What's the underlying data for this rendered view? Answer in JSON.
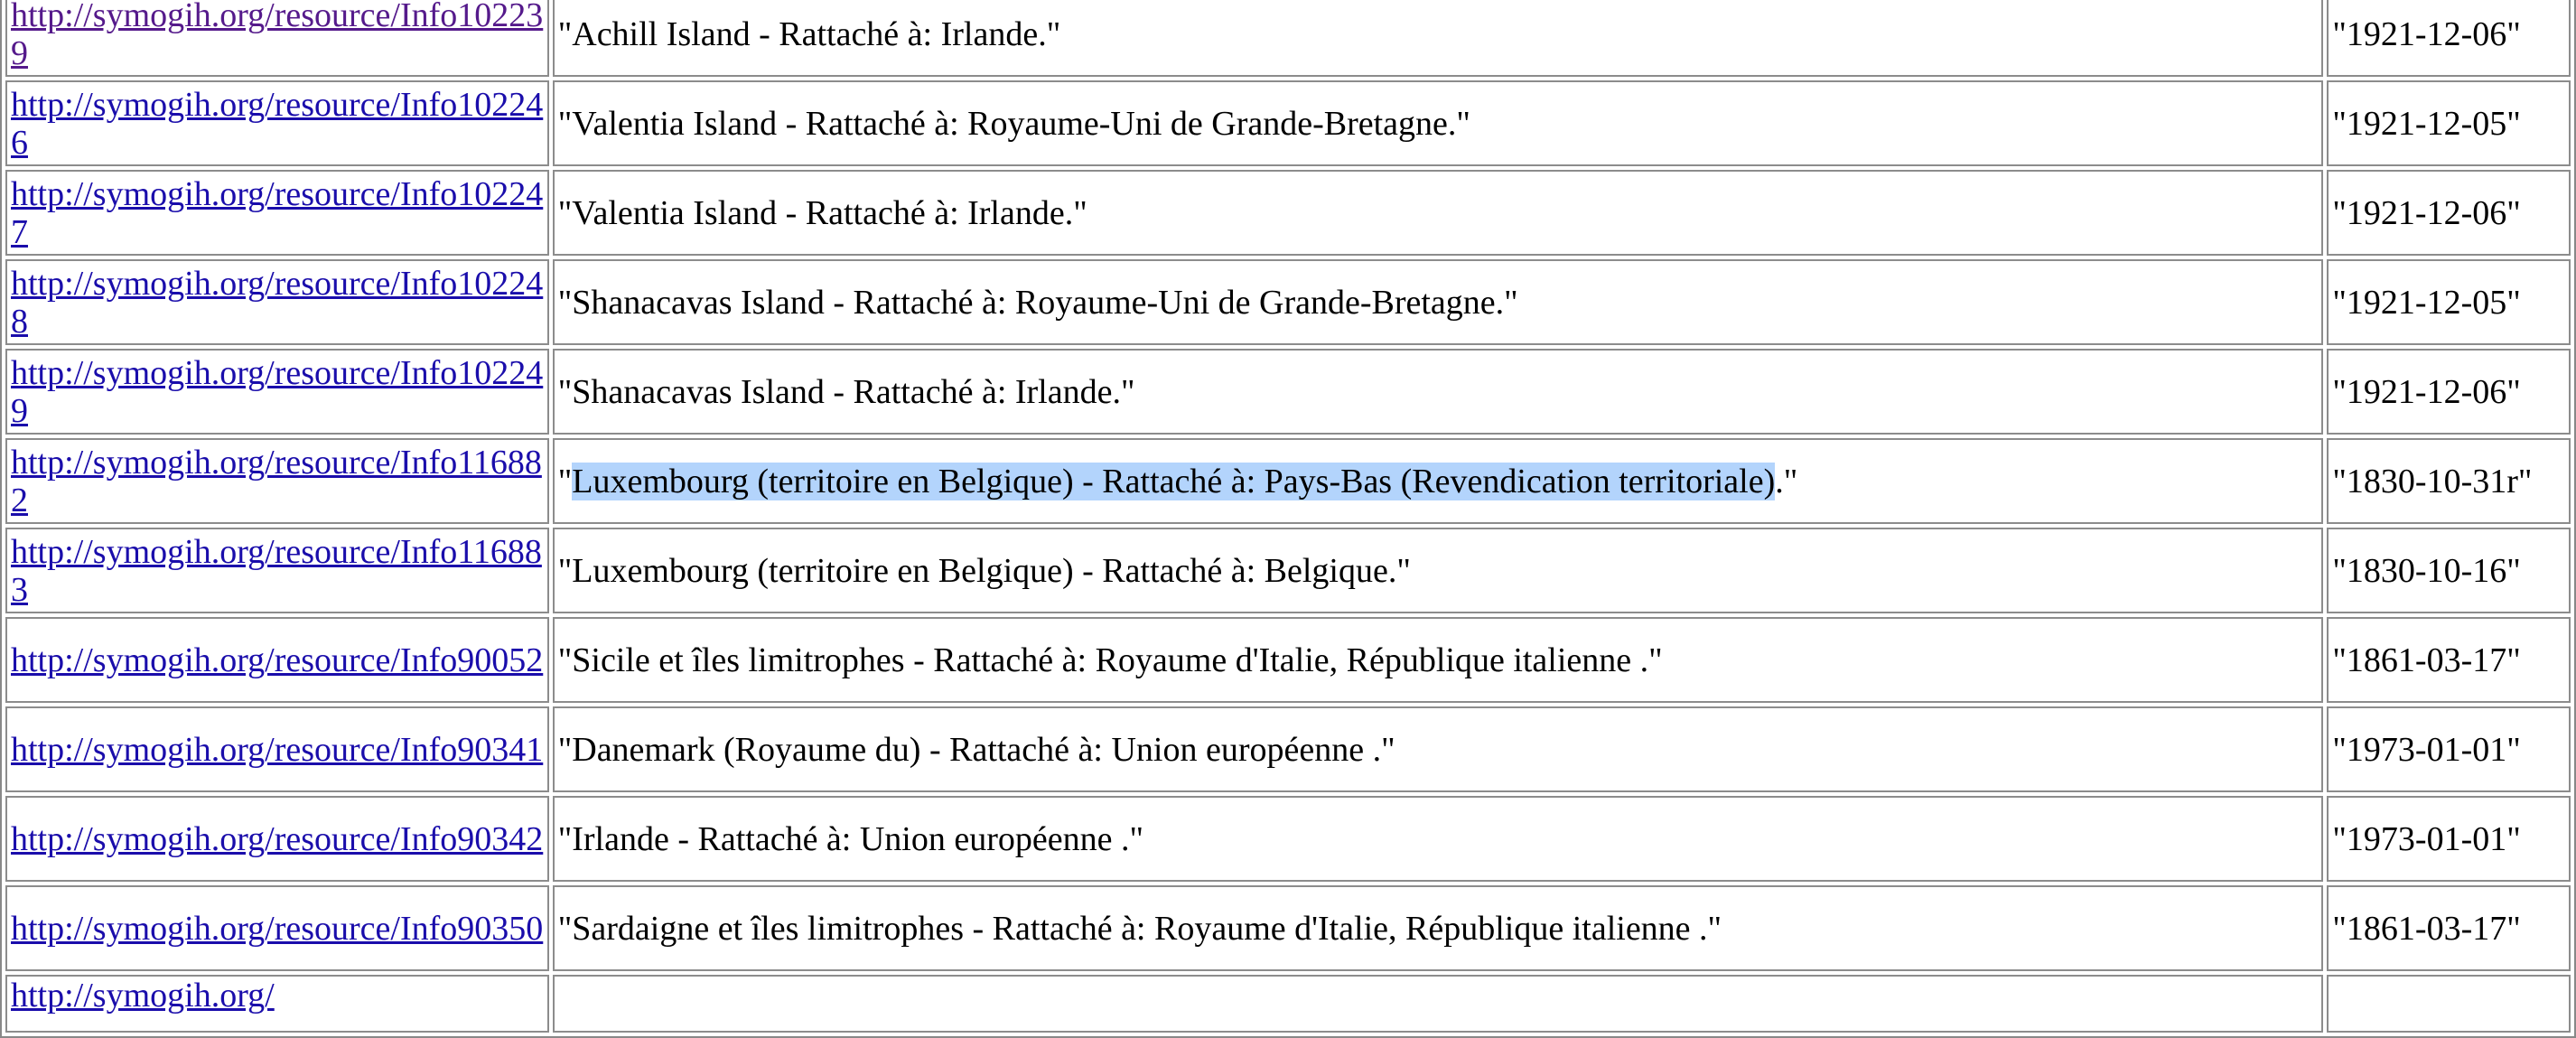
{
  "rows": [
    {
      "link": "http://symogih.org/resource/Info102239",
      "visited": true,
      "desc_pre": "\"",
      "desc_sel": "",
      "desc_post": "Achill Island - Rattaché à: Irlande.\"",
      "date": "\"1921-12-06\""
    },
    {
      "link": "http://symogih.org/resource/Info102246",
      "visited": false,
      "desc_pre": "\"",
      "desc_sel": "",
      "desc_post": "Valentia Island - Rattaché à: Royaume-Uni de Grande-Bretagne.\"",
      "date": "\"1921-12-05\""
    },
    {
      "link": "http://symogih.org/resource/Info102247",
      "visited": false,
      "desc_pre": "\"",
      "desc_sel": "",
      "desc_post": "Valentia Island - Rattaché à: Irlande.\"",
      "date": "\"1921-12-06\""
    },
    {
      "link": "http://symogih.org/resource/Info102248",
      "visited": false,
      "desc_pre": "\"",
      "desc_sel": "",
      "desc_post": "Shanacavas Island - Rattaché à: Royaume-Uni de Grande-Bretagne.\"",
      "date": "\"1921-12-05\""
    },
    {
      "link": "http://symogih.org/resource/Info102249",
      "visited": false,
      "desc_pre": "\"",
      "desc_sel": "",
      "desc_post": "Shanacavas Island - Rattaché à: Irlande.\"",
      "date": "\"1921-12-06\""
    },
    {
      "link": "http://symogih.org/resource/Info116882",
      "visited": false,
      "desc_pre": "\"",
      "desc_sel": "Luxembourg (territoire en Belgique) - Rattaché à: Pays-Bas (Revendication territoriale)",
      "desc_post": ".\"",
      "date": "\"1830-10-31r\""
    },
    {
      "link": "http://symogih.org/resource/Info116883",
      "visited": false,
      "desc_pre": "\"",
      "desc_sel": "",
      "desc_post": "Luxembourg (territoire en Belgique) - Rattaché à: Belgique.\"",
      "date": "\"1830-10-16\""
    },
    {
      "link": "http://symogih.org/resource/Info90052",
      "visited": false,
      "desc_pre": "\"",
      "desc_sel": "",
      "desc_post": "Sicile et îles limitrophes - Rattaché à: Royaume d'Italie, République italienne .\"",
      "date": "\"1861-03-17\""
    },
    {
      "link": "http://symogih.org/resource/Info90341",
      "visited": false,
      "desc_pre": "\"",
      "desc_sel": "",
      "desc_post": "Danemark (Royaume du) - Rattaché à: Union européenne .\"",
      "date": "\"1973-01-01\""
    },
    {
      "link": "http://symogih.org/resource/Info90342",
      "visited": false,
      "desc_pre": "\"",
      "desc_sel": "",
      "desc_post": "Irlande - Rattaché à: Union européenne .\"",
      "date": "\"1973-01-01\""
    },
    {
      "link": "http://symogih.org/resource/Info90350",
      "visited": false,
      "desc_pre": "\"",
      "desc_sel": "",
      "desc_post": "Sardaigne et îles limitrophes - Rattaché à: Royaume d'Italie, République italienne .\"",
      "date": "\"1861-03-17\""
    }
  ],
  "partial_row": {
    "link": "http://symogih.org/"
  },
  "colors": {
    "link": "#1a0dab",
    "visited_link": "#551a8b",
    "selection": "#b3d4fc",
    "border": "#8c8c8c"
  }
}
